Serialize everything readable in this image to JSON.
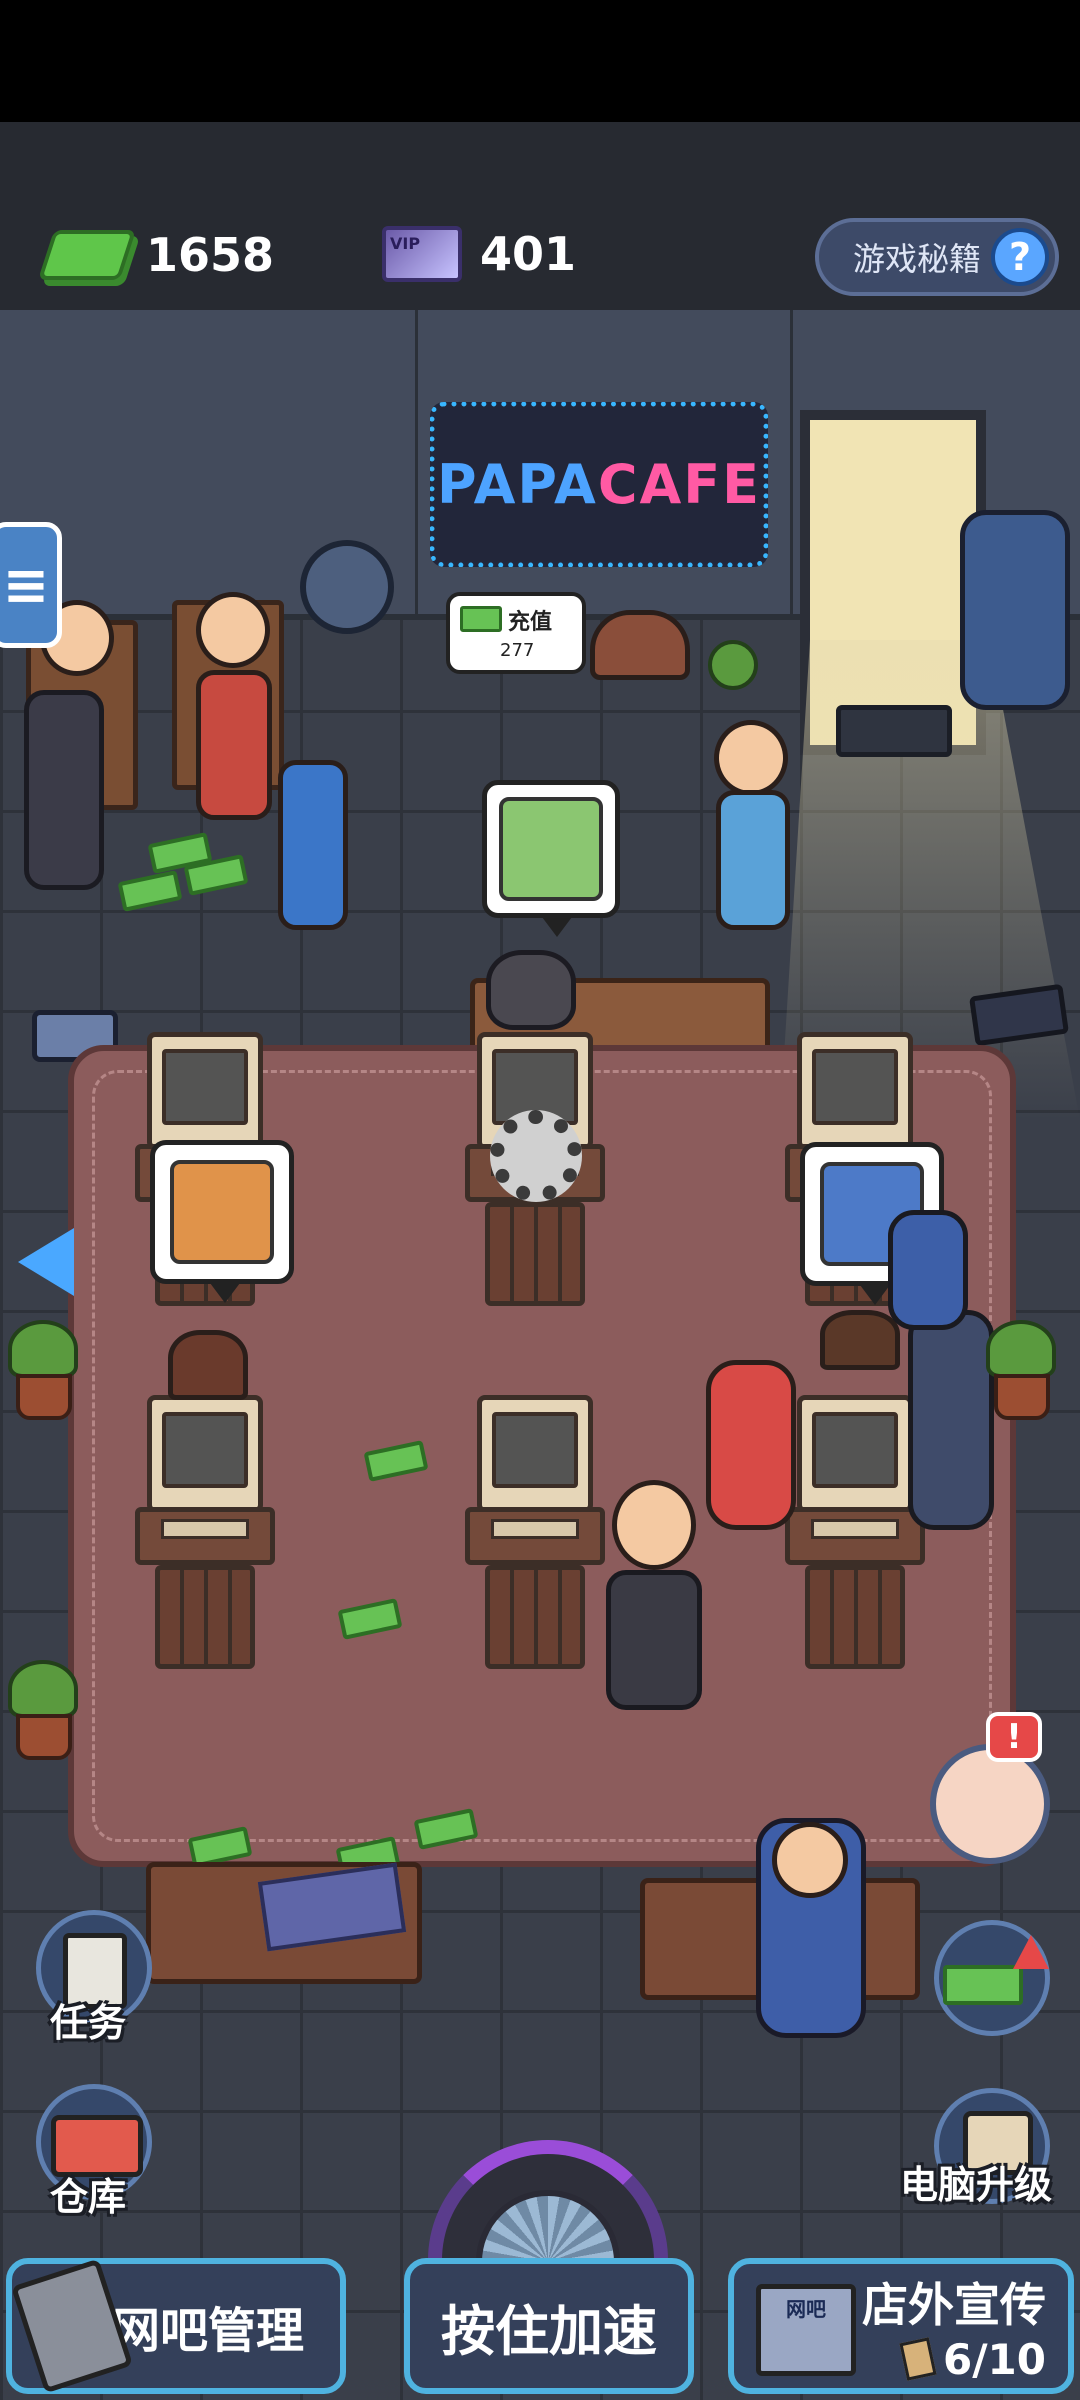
{
  "header": {
    "cash_amount": "1658",
    "vip_amount": "401",
    "vip_icon_text": "VIP",
    "tips_button_label": "游戏秘籍",
    "tips_button_icon": "?"
  },
  "scene": {
    "sign_text_1": "PAPA",
    "sign_text_2": "CAFE",
    "recharge_label": "充值",
    "recharge_value": "277",
    "computer_requests": [
      "pacman-game-icon",
      "settings-gear-icon",
      "racing-car-icon",
      "soldier-character-icon"
    ]
  },
  "side_menu": {
    "menu_icon": "≡",
    "tasks_label": "任务",
    "warehouse_label": "仓库",
    "computer_upgrade_label": "电脑升级",
    "alert_badge": "!"
  },
  "bottom_bar": {
    "manage_label": "网吧管理",
    "speed_label": "按住加速",
    "promo_label": "店外宣传",
    "promo_count": "6/10",
    "promo_icon_text": "网吧"
  },
  "colors": {
    "cash_green": "#5fc64a",
    "accent_blue": "#4fb3e0",
    "carpet": "#8c5c5c",
    "alert_red": "#e64848"
  }
}
